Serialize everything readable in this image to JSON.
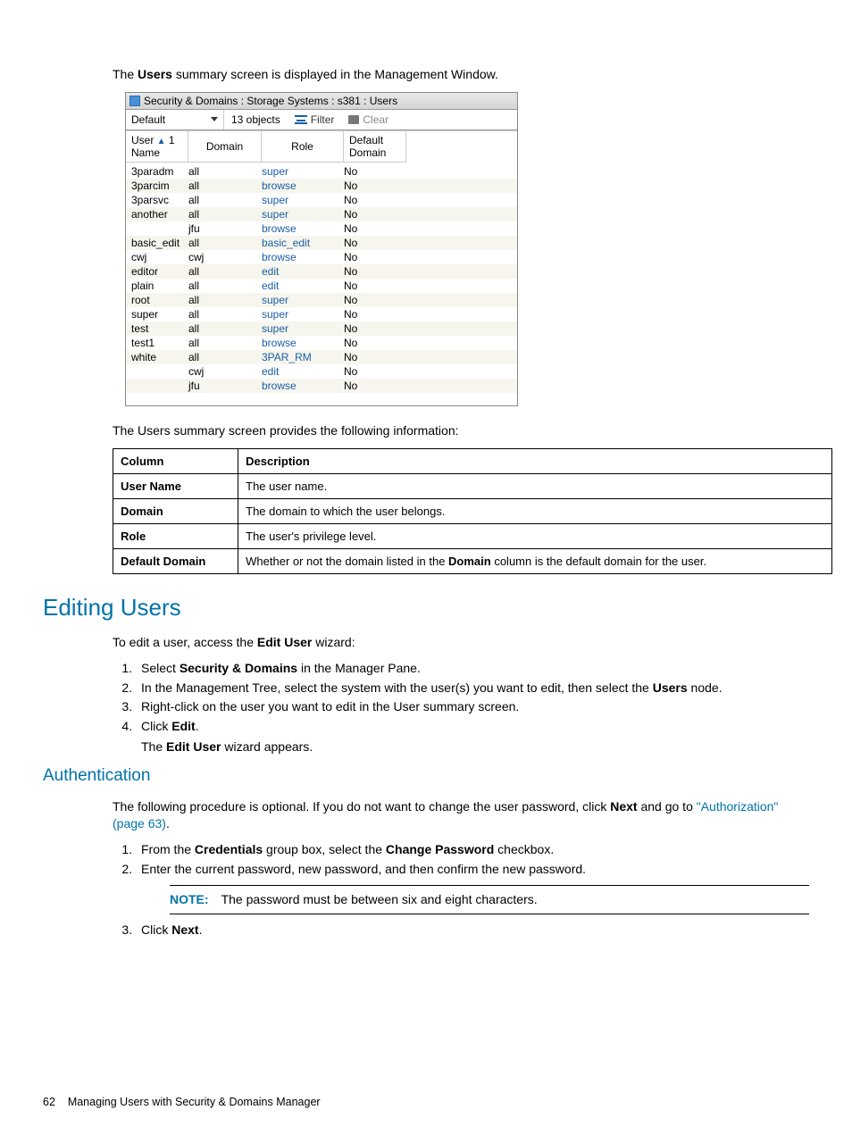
{
  "intro_text": "The Users summary screen is displayed in the Management Window.",
  "window": {
    "title": "Security & Domains : Storage Systems : s381 : Users",
    "combo_value": "Default",
    "object_count": "13 objects",
    "filter_label": "Filter",
    "clear_label": "Clear",
    "headers": {
      "user": "User\nName",
      "sort": "1",
      "domain": "Domain",
      "role": "Role",
      "default": "Default\nDomain"
    },
    "rows": [
      {
        "u": "3paradm",
        "d": "all",
        "r": "super",
        "f": "No",
        "alt": false
      },
      {
        "u": "3parcim",
        "d": "all",
        "r": "browse",
        "f": "No",
        "alt": true
      },
      {
        "u": "3parsvc",
        "d": "all",
        "r": "super",
        "f": "No",
        "alt": false
      },
      {
        "u": "another",
        "d": "all",
        "r": "super",
        "f": "No",
        "alt": true
      },
      {
        "u": "",
        "d": "jfu",
        "r": "browse",
        "f": "No",
        "alt": false
      },
      {
        "u": "basic_edit",
        "d": "all",
        "r": "basic_edit",
        "f": "No",
        "alt": true
      },
      {
        "u": "cwj",
        "d": "cwj",
        "r": "browse",
        "f": "No",
        "alt": false
      },
      {
        "u": "editor",
        "d": "all",
        "r": "edit",
        "f": "No",
        "alt": true
      },
      {
        "u": "plain",
        "d": "all",
        "r": "edit",
        "f": "No",
        "alt": false
      },
      {
        "u": "root",
        "d": "all",
        "r": "super",
        "f": "No",
        "alt": true
      },
      {
        "u": "super",
        "d": "all",
        "r": "super",
        "f": "No",
        "alt": false
      },
      {
        "u": "test",
        "d": "all",
        "r": "super",
        "f": "No",
        "alt": true
      },
      {
        "u": "test1",
        "d": "all",
        "r": "browse",
        "f": "No",
        "alt": false
      },
      {
        "u": "white",
        "d": "all",
        "r": "3PAR_RM",
        "f": "No",
        "alt": true
      },
      {
        "u": "",
        "d": "cwj",
        "r": "edit",
        "f": "No",
        "alt": false
      },
      {
        "u": "",
        "d": "jfu",
        "r": "browse",
        "f": "No",
        "alt": true
      }
    ]
  },
  "summary_text": "The Users summary screen provides the following information:",
  "table": {
    "h1": "Column",
    "h2": "Description",
    "rows": [
      {
        "c": "User Name",
        "d": "The user name."
      },
      {
        "c": "Domain",
        "d": "The domain to which the user belongs."
      },
      {
        "c": "Role",
        "d": "The user's privilege level."
      },
      {
        "c": "Default Domain",
        "d_pre": "Whether or not the domain listed in the ",
        "d_bold": "Domain",
        "d_post": " column is the default domain for the user."
      }
    ]
  },
  "h2_edit": "Editing Users",
  "edit_intro_pre": "To edit a user, access the ",
  "edit_intro_bold": "Edit User",
  "edit_intro_post": " wizard:",
  "edit_steps": {
    "s1_pre": "Select ",
    "s1_bold": "Security & Domains",
    "s1_post": " in the Manager Pane.",
    "s2_pre": "In the Management Tree, select the system with the user(s) you want to edit, then select the ",
    "s2_bold": "Users",
    "s2_post": " node.",
    "s3": "Right-click on the user you want to edit in the User summary screen.",
    "s4_pre": "Click ",
    "s4_bold": "Edit",
    "s4_post": ".",
    "s4_sub_pre": "The ",
    "s4_sub_bold": "Edit User",
    "s4_sub_post": " wizard appears."
  },
  "h3_auth": "Authentication",
  "auth_intro_pre": "The following procedure is optional. If you do not want to change the user password, click ",
  "auth_intro_bold": "Next",
  "auth_intro_post": " and go to ",
  "auth_link": "\"Authorization\" (page 63)",
  "auth_intro_end": ".",
  "auth_steps": {
    "s1_pre": "From the ",
    "s1_b1": "Credentials",
    "s1_mid": " group box, select the ",
    "s1_b2": "Change Password",
    "s1_post": " checkbox.",
    "s2": "Enter the current password, new password, and then confirm the new password.",
    "note_label": "NOTE:",
    "note_text": "The password must be between six and eight characters.",
    "s3_pre": "Click ",
    "s3_bold": "Next",
    "s3_post": "."
  },
  "footer": {
    "page": "62",
    "title": "Managing Users with Security & Domains Manager"
  }
}
